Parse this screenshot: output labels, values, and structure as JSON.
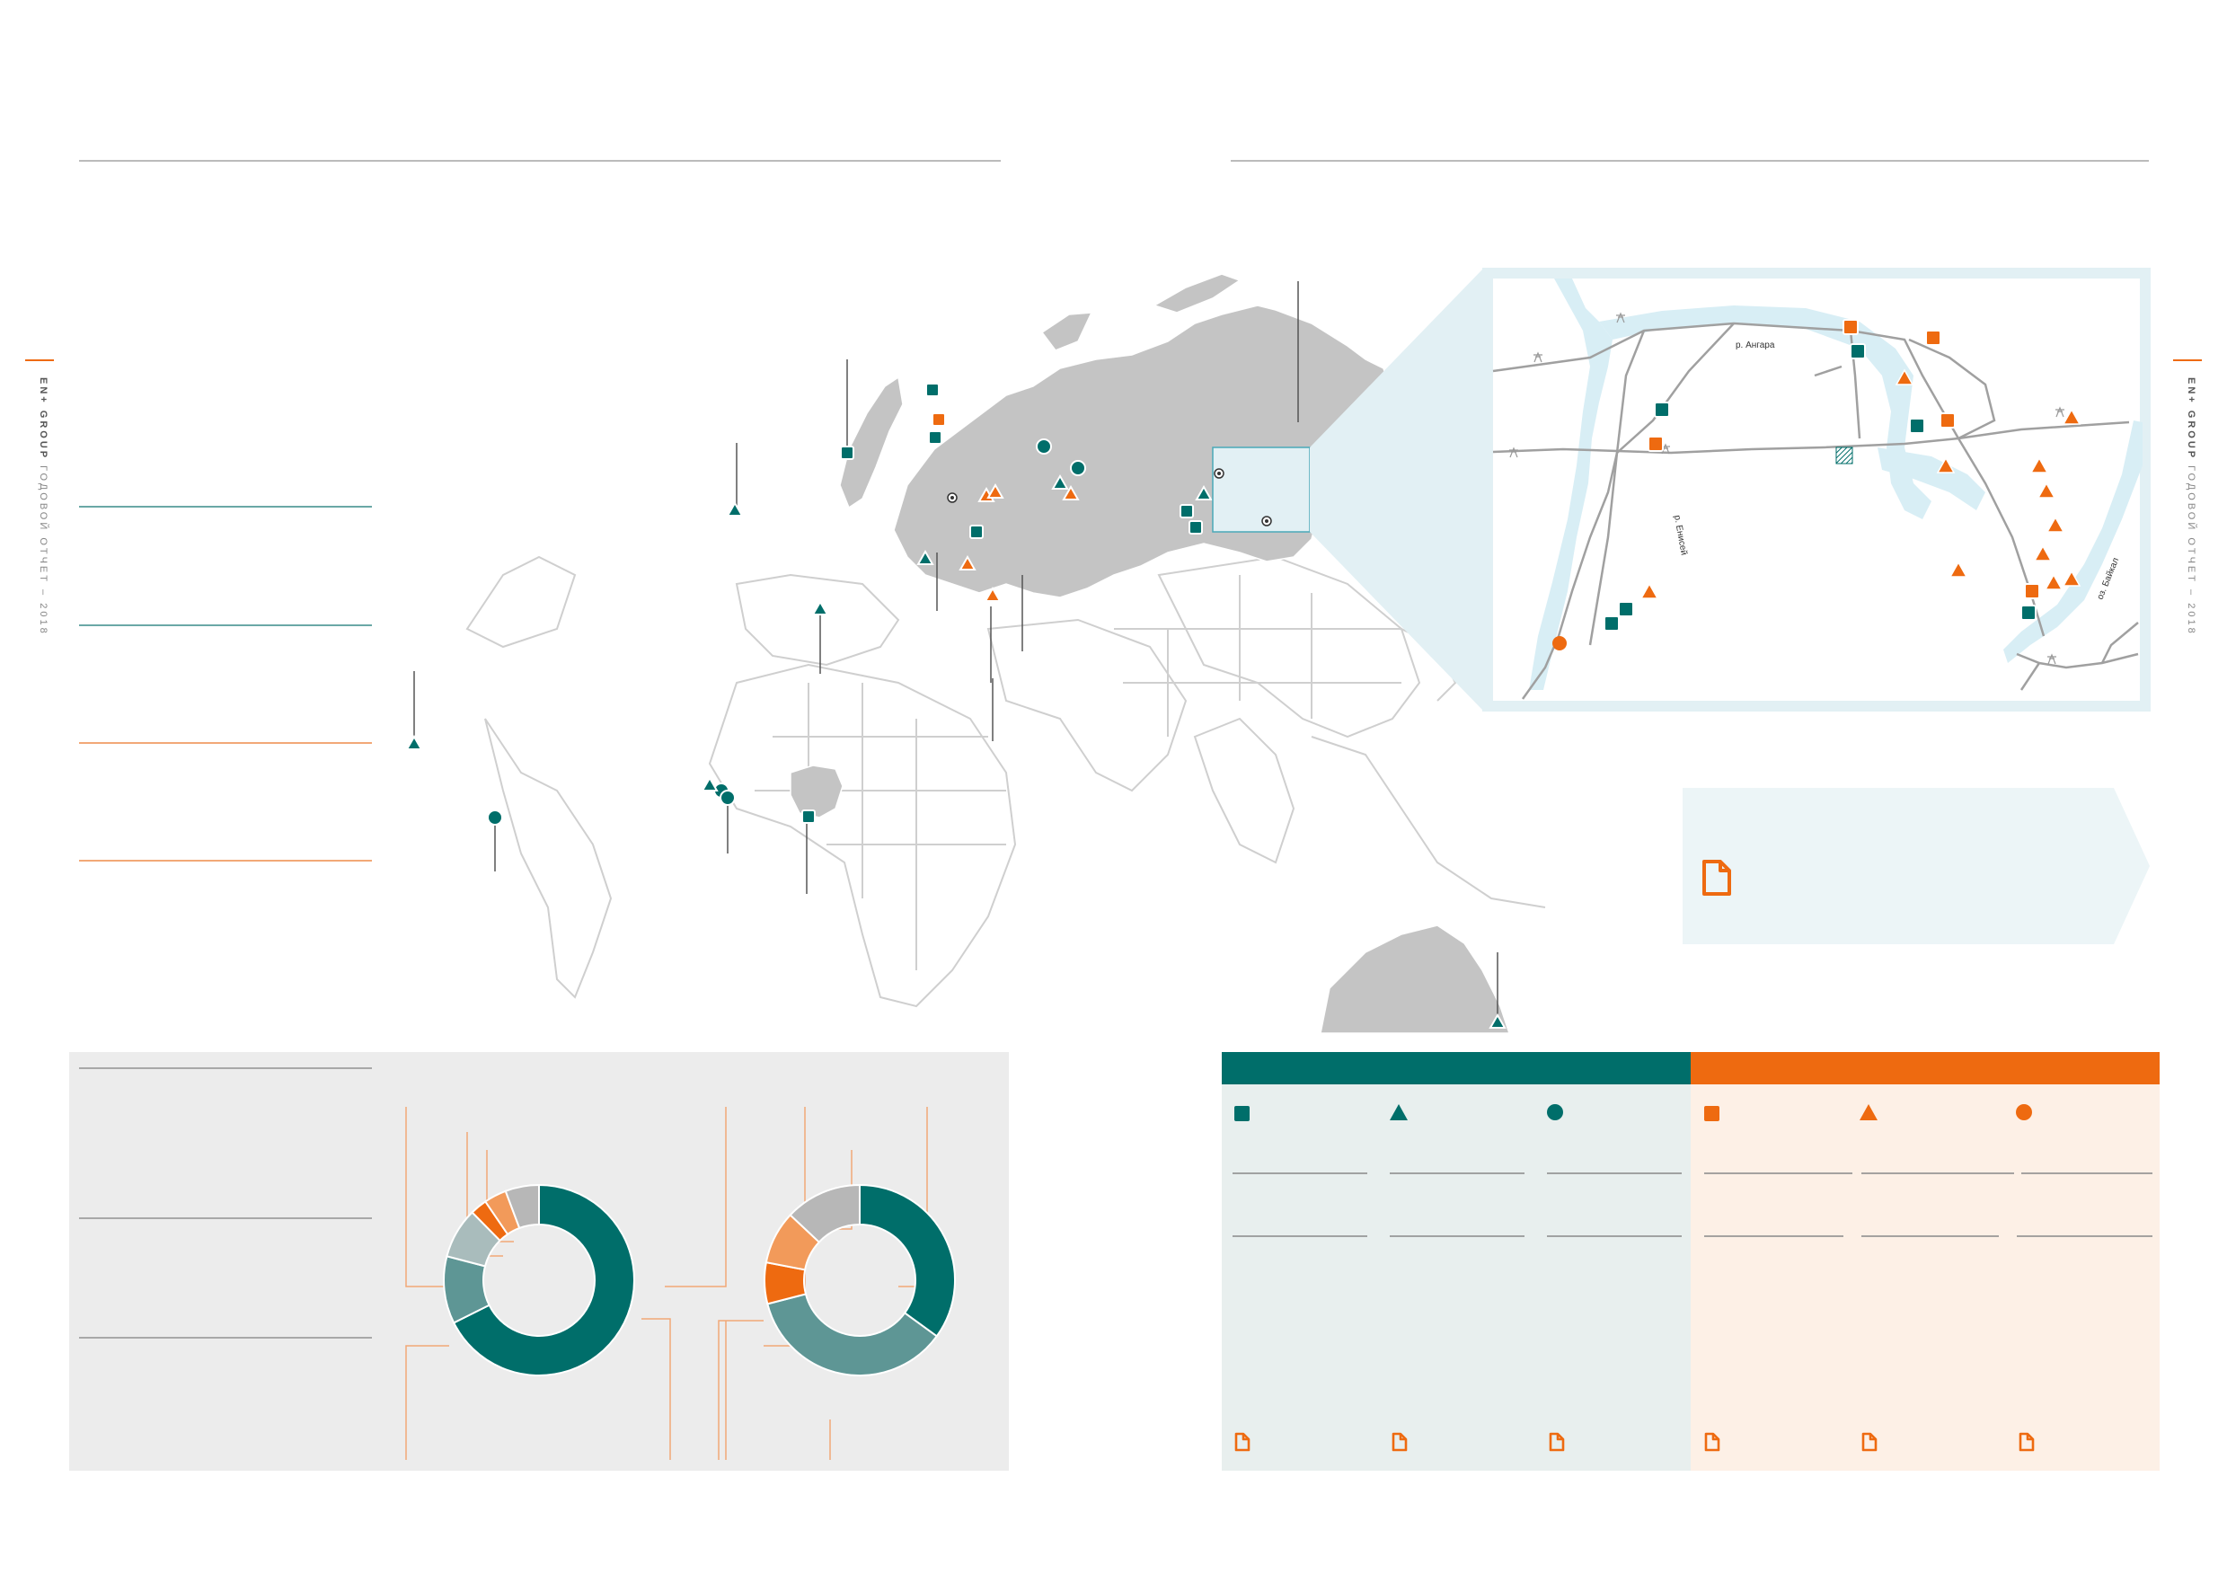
{
  "sidebar": {
    "brand": "EN+ GROUP",
    "report_title": "ГОДОВОЙ ОТЧЕТ",
    "year": "2018"
  },
  "inset_map": {
    "river_angara": "р. Ангара",
    "river_yenisei": "р. Енисей",
    "lake_baikal": "оз. Байкал"
  },
  "colors": {
    "teal": "#006e6a",
    "orange": "#ee6a10",
    "map_grey": "#c4c4c4",
    "light_blue": "#e2f0f4",
    "panel_grey": "#ececec",
    "panel_green": "#e8efee",
    "panel_orange": "#fdf0e6"
  },
  "legend_icons": {
    "teal": [
      "teal-square-icon",
      "teal-triangle-icon",
      "teal-circle-icon"
    ],
    "orange": [
      "orange-square-icon",
      "orange-triangle-icon",
      "orange-circle-icon"
    ]
  },
  "chart_data": [
    {
      "type": "pie",
      "values": [
        71,
        12,
        9,
        3,
        4,
        6
      ],
      "colors": [
        "#006e6a",
        "#5e9695",
        "#a9bcbc",
        "#ee6a10",
        "#f29a5a",
        "#b7b7b7"
      ]
    },
    {
      "type": "pie",
      "values": [
        35,
        36,
        7,
        9,
        13
      ],
      "colors": [
        "#006e6a",
        "#5e9695",
        "#ee6a10",
        "#f29a5a",
        "#b7b7b7"
      ]
    }
  ]
}
